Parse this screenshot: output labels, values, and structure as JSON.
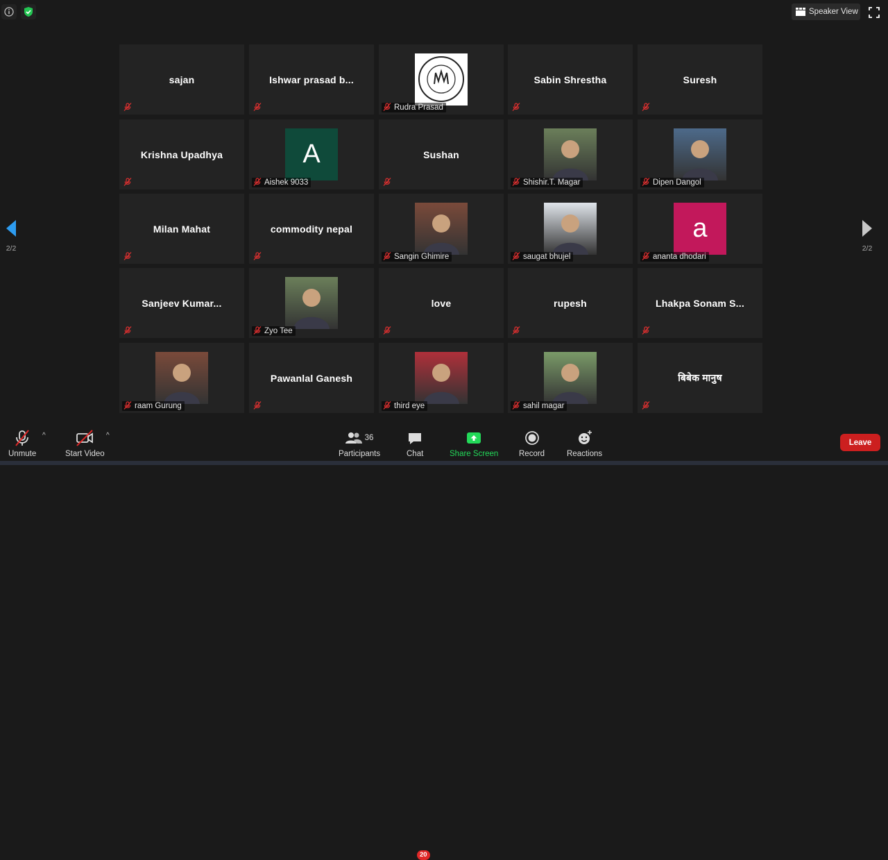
{
  "top": {
    "speaker_view_label": "Speaker View"
  },
  "nav": {
    "left_page": "2/2",
    "right_page": "2/2"
  },
  "tiles": [
    {
      "name": "sajan",
      "kind": "text"
    },
    {
      "name": "Ishwar prasad b...",
      "kind": "text"
    },
    {
      "name": "Rudra Prasad",
      "kind": "logo"
    },
    {
      "name": "Sabin Shrestha",
      "kind": "text"
    },
    {
      "name": "Suresh",
      "kind": "text"
    },
    {
      "name": "Krishna Upadhya",
      "kind": "text"
    },
    {
      "name": "Aishek 9033",
      "kind": "letter",
      "letter": "A",
      "color": "#0f4a3a"
    },
    {
      "name": "Sushan",
      "kind": "text"
    },
    {
      "name": "Shishir.T. Magar",
      "kind": "photo"
    },
    {
      "name": "Dipen Dangol",
      "kind": "photo"
    },
    {
      "name": "Milan Mahat",
      "kind": "text"
    },
    {
      "name": "commodity nepal",
      "kind": "text"
    },
    {
      "name": "Sangin Ghimire",
      "kind": "photo"
    },
    {
      "name": "saugat bhujel",
      "kind": "photo"
    },
    {
      "name": "ananta dhodari",
      "kind": "letter",
      "letter": "a",
      "color": "#c2185b"
    },
    {
      "name": "Sanjeev  Kumar...",
      "kind": "text"
    },
    {
      "name": "Zyo Tee",
      "kind": "photo"
    },
    {
      "name": "love",
      "kind": "text"
    },
    {
      "name": "rupesh",
      "kind": "text"
    },
    {
      "name": "Lhakpa  Sonam  S...",
      "kind": "text"
    },
    {
      "name": "raam Gurung",
      "kind": "photo"
    },
    {
      "name": "Pawanlal Ganesh",
      "kind": "text"
    },
    {
      "name": "third eye",
      "kind": "photo"
    },
    {
      "name": "sahil magar",
      "kind": "photo"
    },
    {
      "name": "बिबेक मानुष",
      "kind": "text"
    }
  ],
  "toolbar": {
    "unmute_label": "Unmute",
    "start_video_label": "Start Video",
    "participants_label": "Participants",
    "participants_count": "36",
    "chat_label": "Chat",
    "chat_badge": "20",
    "share_label": "Share Screen",
    "record_label": "Record",
    "reactions_label": "Reactions",
    "leave_label": "Leave"
  },
  "colors": {
    "share_green": "#23d959",
    "leave_red": "#cc1f1f",
    "nav_blue": "#2d9cf0"
  }
}
